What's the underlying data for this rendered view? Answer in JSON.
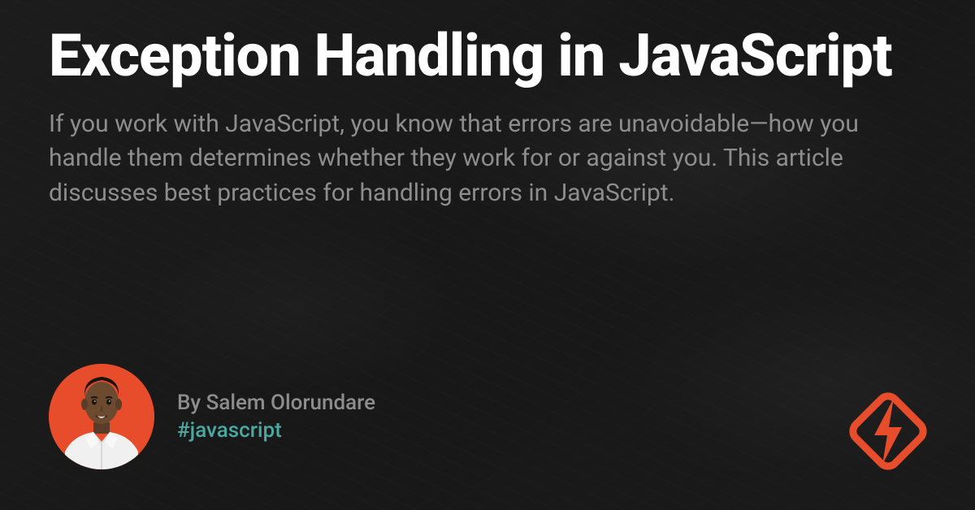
{
  "title": "Exception Handling in JavaScript",
  "description": "If you work with JavaScript, you know that errors are unavoidable—how you handle them determines whether they work for or against you. This article discusses best practices for handling errors in JavaScript.",
  "author": {
    "byline": "By Salem Olorundare",
    "hashtag": "#javascript"
  },
  "colors": {
    "accent": "#e74c2b",
    "hashtag": "#4aa8a0",
    "text_muted": "#8d8d8d",
    "background": "#1a1a1a"
  }
}
